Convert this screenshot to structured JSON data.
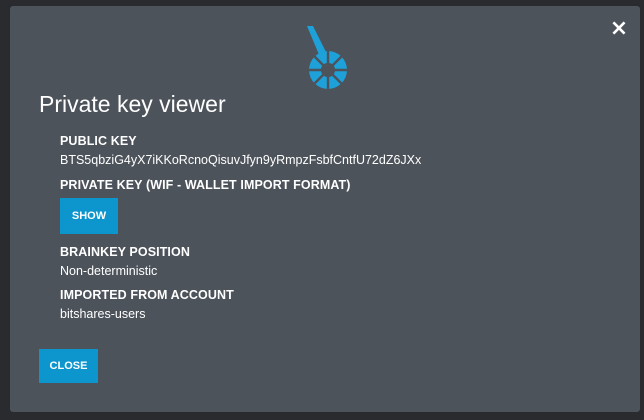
{
  "dialog": {
    "title": "Private key viewer",
    "close_icon": "close-x-icon",
    "logo_icon": "bitshares-logo-icon",
    "accent_color": "#0d95cd",
    "background_color": "#4d535b"
  },
  "fields": {
    "public_key_label": "PUBLIC KEY",
    "public_key_value": "BTS5qbziG4yX7iKKoRcnoQisuvJfyn9yRmpzFsbfCntfU72dZ6JXx",
    "private_key_label": "PRIVATE KEY (WIF - WALLET IMPORT FORMAT)",
    "show_button": "SHOW",
    "brainkey_label": "BRAINKEY POSITION",
    "brainkey_value": "Non-deterministic",
    "imported_label": "IMPORTED FROM ACCOUNT",
    "imported_value": "bitshares-users"
  },
  "footer": {
    "close_button": "CLOSE"
  }
}
